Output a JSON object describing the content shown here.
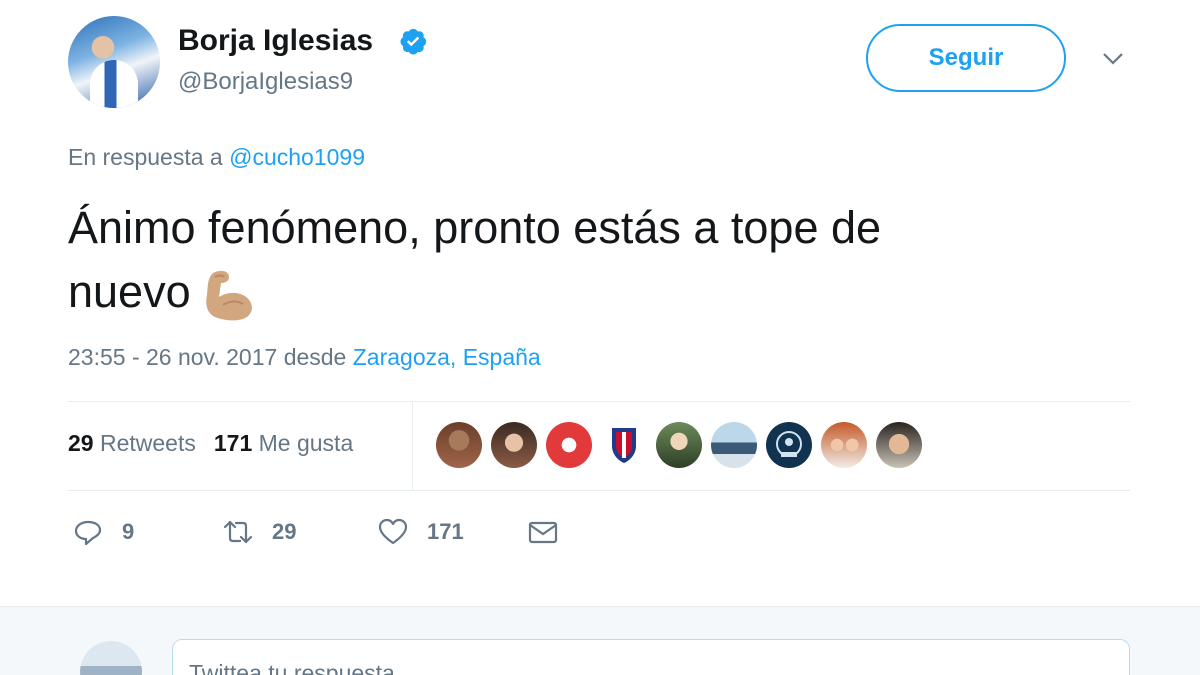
{
  "author": {
    "name": "Borja Iglesias",
    "handle": "@BorjaIglesias9",
    "verified": true
  },
  "follow_button_label": "Seguir",
  "reply_context": {
    "prefix": "En respuesta a",
    "mention": "@cucho1099"
  },
  "tweet": {
    "text_line1": "Ánimo fenómeno, pronto estás a tope de",
    "text_line2": "nuevo",
    "emoji": "flexed-biceps",
    "time": "23:55 - 26 nov. 2017",
    "from_word": "desde",
    "location": "Zaragoza, España"
  },
  "stats": {
    "retweets_count": "29",
    "retweets_label": "Retweets",
    "likes_count": "171",
    "likes_label": "Me gusta"
  },
  "actions": {
    "reply_count": "9",
    "retweet_count": "29",
    "like_count": "171"
  },
  "liker_avatars": [
    "liker-1",
    "liker-2",
    "liker-3",
    "liker-4-crest",
    "liker-5",
    "liker-6",
    "liker-7-badge",
    "liker-8",
    "liker-9"
  ],
  "reply_box": {
    "placeholder": "Twittea tu respuesta"
  },
  "colors": {
    "accent": "#1da1f2",
    "muted": "#657786",
    "text": "#14171a",
    "divider": "#e6ecf0"
  }
}
